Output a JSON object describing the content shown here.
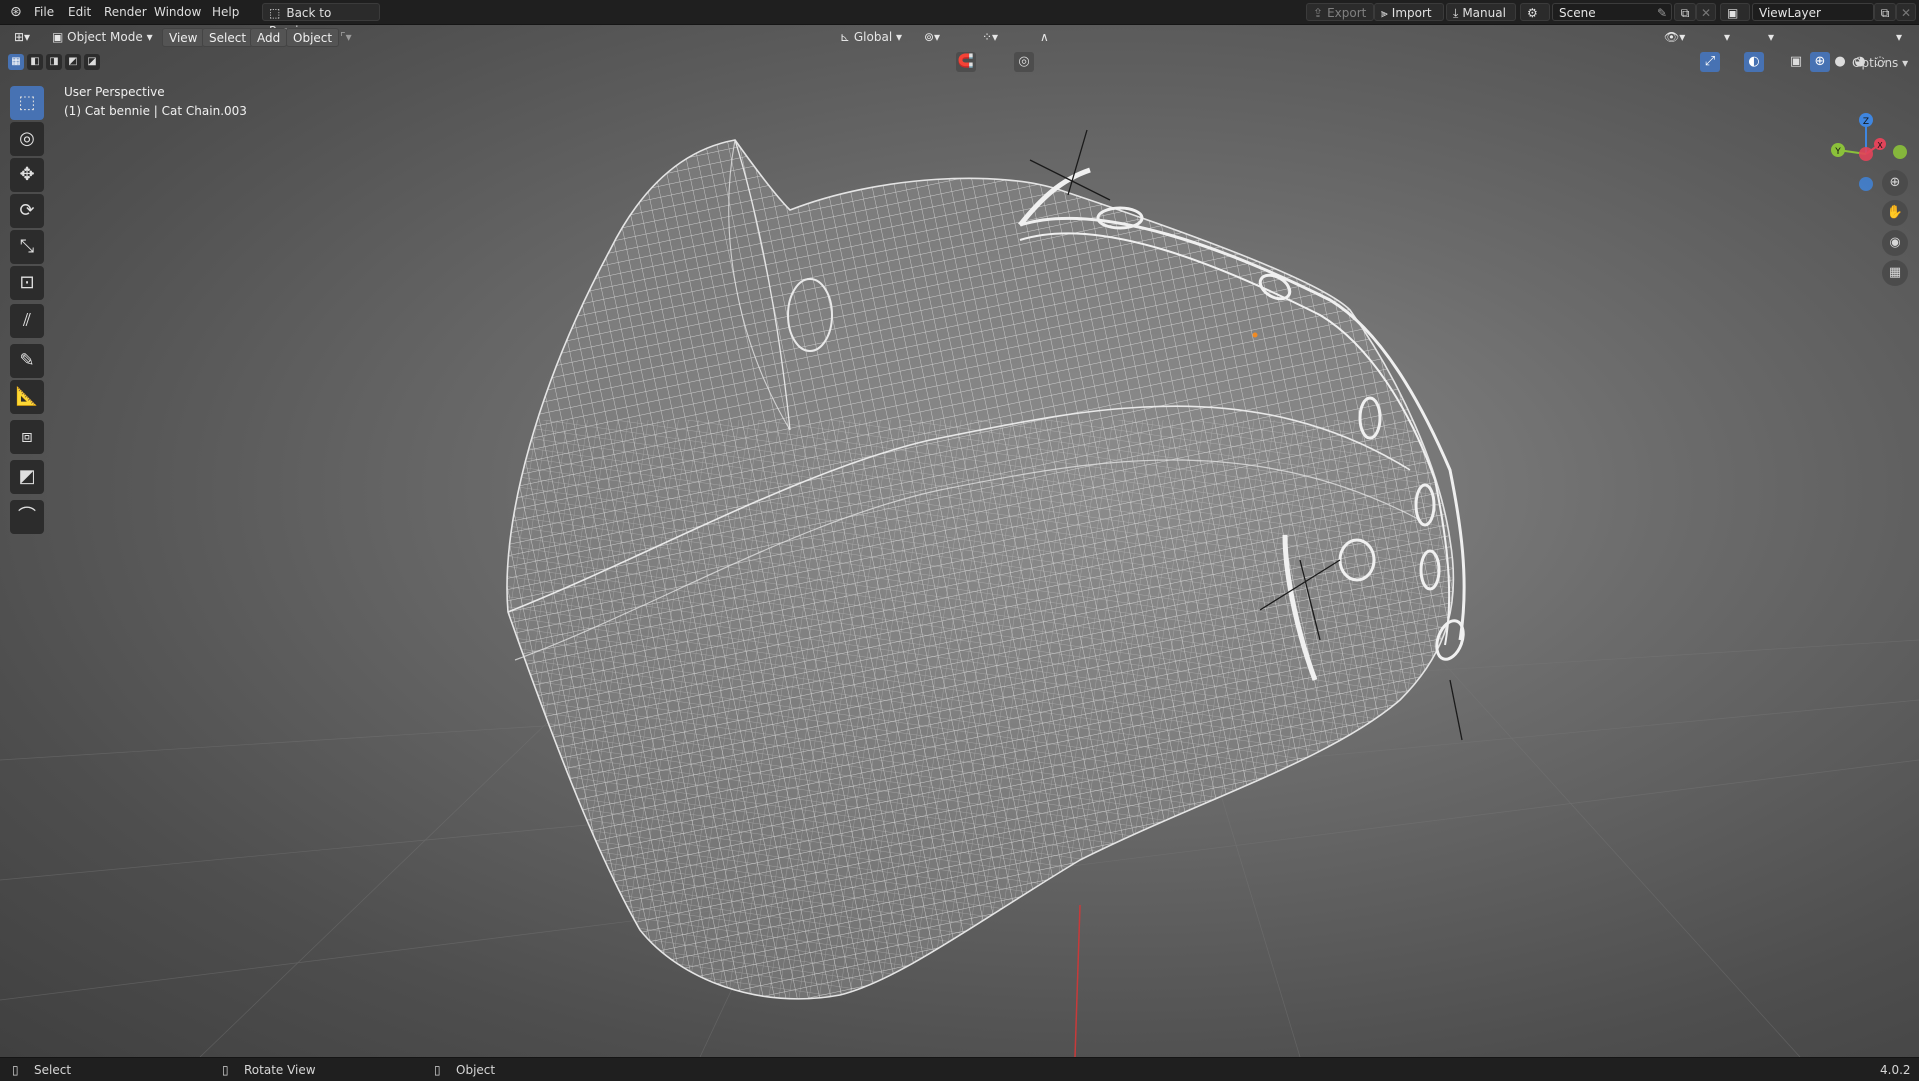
{
  "menu": {
    "items": [
      "File",
      "Edit",
      "Render",
      "Window",
      "Help"
    ],
    "back_button": "Back to Previous"
  },
  "topright": {
    "export_label": "Export",
    "import_label": "Import",
    "manual_label": "Manual",
    "scene_name": "Scene",
    "view_layer": "ViewLayer"
  },
  "header": {
    "mode": "Object Mode",
    "view": "View",
    "select": "Select",
    "add": "Add",
    "object": "Object",
    "transform_orientation": "Global",
    "options": "Options"
  },
  "viewport": {
    "perspective_label": "User Perspective",
    "object_label": "(1) Cat bennie | Cat Chain.003",
    "axes": {
      "x": "X",
      "y": "Y",
      "z": "Z"
    },
    "colors": {
      "x_axis": "#e2445a",
      "y_axis": "#8bc13a",
      "z_axis": "#3f86e0",
      "wire": "#dcdcdc"
    }
  },
  "toolbar": {
    "tools": [
      "select-box",
      "cursor",
      "move",
      "rotate",
      "scale",
      "transform",
      "annotate",
      "annotate-line",
      "measure",
      "add-cube",
      "shear",
      "bend"
    ],
    "active": "select-box"
  },
  "statusbar": {
    "select": "Select",
    "rotate_view": "Rotate View",
    "object": "Object",
    "version": "4.0.2"
  }
}
